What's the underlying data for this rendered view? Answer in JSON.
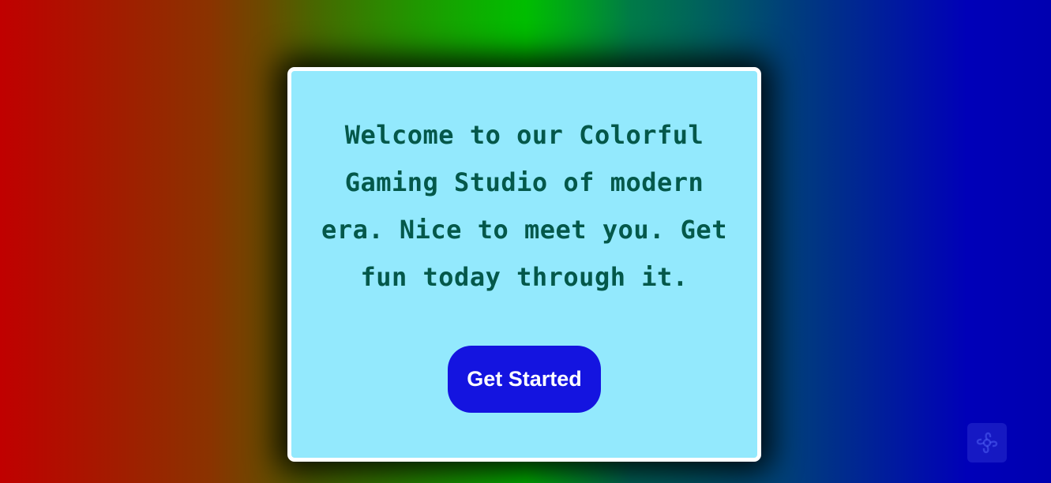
{
  "hero": {
    "message": "Welcome to our Colorful Gaming Studio of modern era. Nice to meet you. Get fun today through it.",
    "cta_label": "Get Started"
  },
  "colors": {
    "card_background": "#93e9fd",
    "text": "#04584a",
    "button": "#1414e0"
  },
  "icons": {
    "corner_logo": "flower-logo-icon"
  }
}
